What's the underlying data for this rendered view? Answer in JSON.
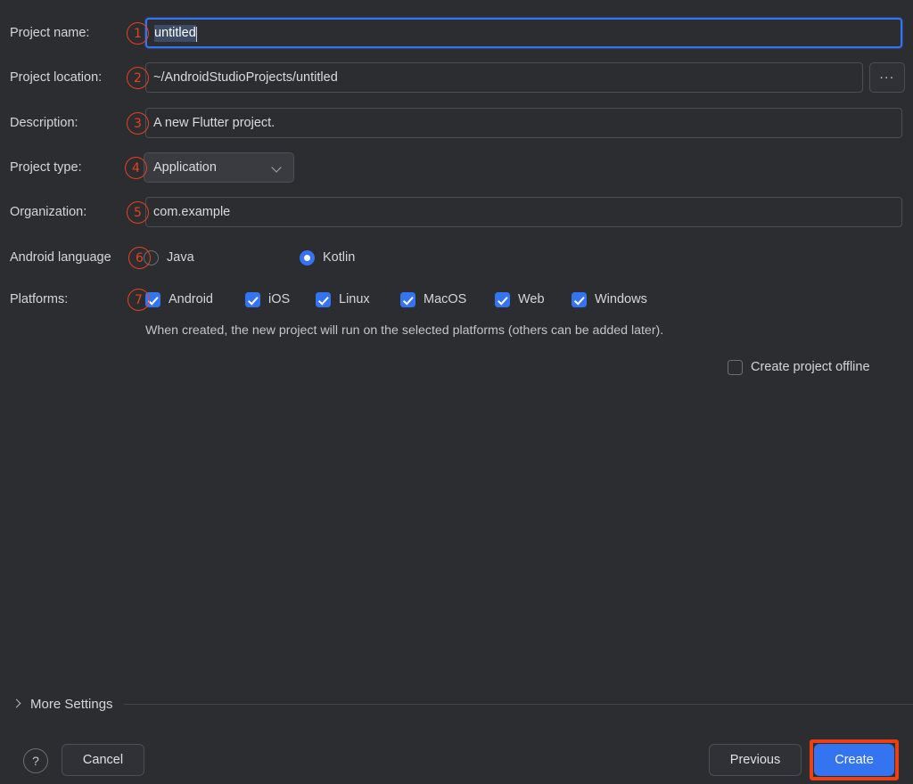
{
  "dialog": {
    "background_color": "#2b2d30",
    "accent_color": "#3574f0",
    "annotation_color": "#e8411f"
  },
  "fields": {
    "project_name": {
      "label": "Project name:",
      "value": "untitled",
      "selected": true,
      "focused": true,
      "badge": "1"
    },
    "project_location": {
      "label": "Project location:",
      "value": "~/AndroidStudioProjects/untitled",
      "badge": "2",
      "browse_label": "..."
    },
    "description": {
      "label": "Description:",
      "value": "A new Flutter project.",
      "badge": "3"
    },
    "project_type": {
      "label": "Project type:",
      "value": "Application",
      "badge": "4"
    },
    "organization": {
      "label": "Organization:",
      "value": "com.example",
      "badge": "5"
    },
    "android_language": {
      "label": "Android language",
      "badge": "6",
      "options": [
        {
          "label": "Java",
          "selected": false
        },
        {
          "label": "Kotlin",
          "selected": true
        }
      ]
    },
    "platforms": {
      "label": "Platforms:",
      "badge": "7",
      "options": [
        {
          "label": "Android",
          "checked": true
        },
        {
          "label": "iOS",
          "checked": true
        },
        {
          "label": "Linux",
          "checked": true
        },
        {
          "label": "MacOS",
          "checked": true
        },
        {
          "label": "Web",
          "checked": true
        },
        {
          "label": "Windows",
          "checked": true
        }
      ],
      "helper_text": "When created, the new project will run on the selected platforms (others can be added later)."
    },
    "create_offline": {
      "label": "Create project offline",
      "checked": false
    }
  },
  "more_settings": {
    "label": "More Settings",
    "expanded": false
  },
  "footer": {
    "help_label": "?",
    "cancel_label": "Cancel",
    "previous_label": "Previous",
    "create_label": "Create"
  }
}
